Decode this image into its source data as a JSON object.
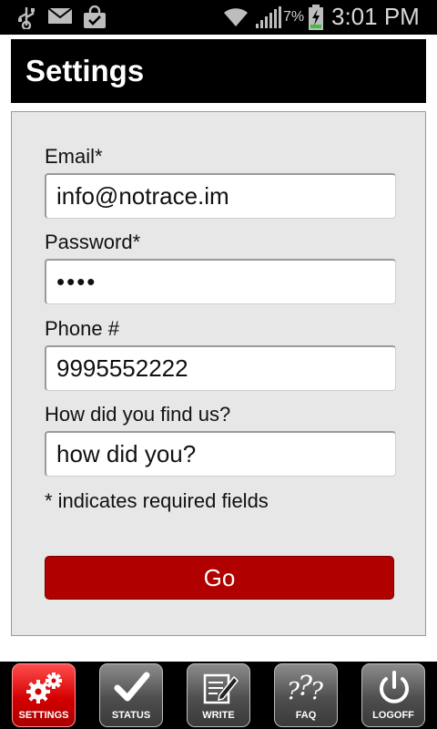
{
  "status_bar": {
    "battery_percent": "7%",
    "time": "3:01 PM",
    "icons": [
      "usb-icon",
      "mail-icon",
      "shopping-bag-icon",
      "wifi-icon",
      "signal-icon",
      "battery-charging-icon"
    ]
  },
  "header": {
    "title": "Settings"
  },
  "form": {
    "email_label": "Email*",
    "email_value": "info@notrace.im",
    "password_label": "Password*",
    "password_value": "••••",
    "phone_label": "Phone #",
    "phone_value": "9995552222",
    "find_label": "How did you find us?",
    "find_value": "how did you?",
    "required_note": "* indicates required fields",
    "go_label": "Go"
  },
  "nav": {
    "items": [
      {
        "label": "SETTINGS",
        "icon": "gears-icon",
        "active": true
      },
      {
        "label": "STATUS",
        "icon": "checkmark-icon",
        "active": false
      },
      {
        "label": "WRITE",
        "icon": "pencil-note-icon",
        "active": false
      },
      {
        "label": "FAQ",
        "icon": "question-marks-icon",
        "active": false
      },
      {
        "label": "LOGOFF",
        "icon": "power-icon",
        "active": false
      }
    ]
  },
  "colors": {
    "accent_red": "#b00000",
    "panel_bg": "#e7e7e7",
    "header_bg": "#000000"
  }
}
